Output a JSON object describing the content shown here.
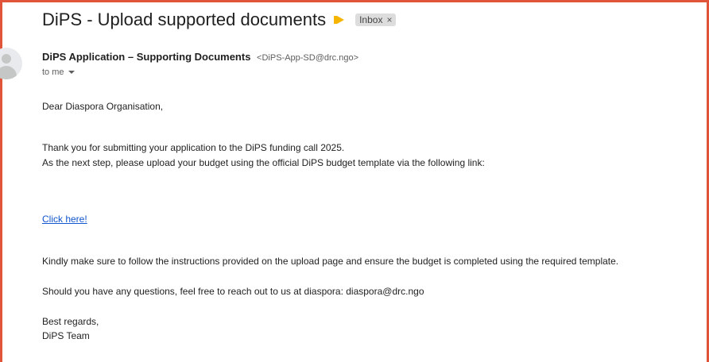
{
  "email": {
    "subject": "DiPS - Upload supported documents",
    "label": "Inbox",
    "sender_name": "DiPS Application – Supporting Documents",
    "sender_email": "<DiPS-App-SD@drc.ngo>",
    "to": "to me",
    "greeting": "Dear Diaspora Organisation,",
    "para1_line1": "Thank you for submitting your application to the DiPS funding call 2025.",
    "para1_line2": "As the next step, please upload your budget using the official DiPS budget template via the following link:",
    "link_text": "Click here!",
    "para2": "Kindly make sure to follow the instructions provided on the upload page and ensure the budget is completed using the required template.",
    "para3": "Should you have any questions, feel free to reach out to us at diaspora: diaspora@drc.ngo",
    "signoff": "Best regards,",
    "signature": "DiPS Team"
  },
  "colors": {
    "frame": "#e0543a",
    "link": "#1155cc",
    "importance": "#f4b400"
  },
  "icons": {
    "importance": "importance-marker-icon",
    "avatar": "default-avatar-icon",
    "close": "close-icon",
    "dropdown": "caret-down-icon"
  }
}
